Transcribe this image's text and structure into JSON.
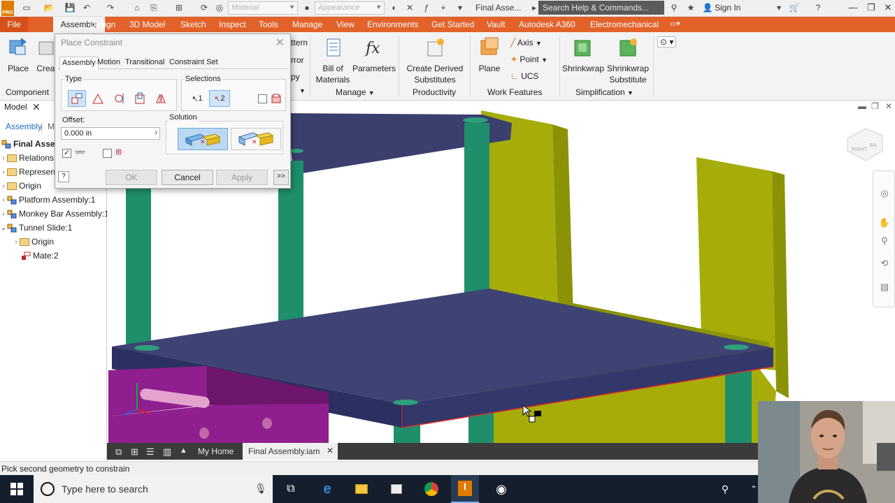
{
  "titlebar": {
    "app_logo": "PRO",
    "material_placeholder": "Material",
    "appearance_placeholder": "Appearance",
    "doc_title": "Final Asse...",
    "search_placeholder": "Search Help & Commands...",
    "sign_in": "Sign In"
  },
  "tabs": {
    "file": "File",
    "items": [
      "Assemble",
      "Design",
      "3D Model",
      "Sketch",
      "Inspect",
      "Tools",
      "Manage",
      "View",
      "Environments",
      "Get Started",
      "Vault",
      "Autodesk A360",
      "Electromechanical"
    ]
  },
  "ribbon": {
    "place": "Place",
    "create": "Creat",
    "component_group": "Component",
    "pattern": "ttern",
    "mirror": "rror",
    "copy": "py",
    "bill_of_materials_1": "Bill of",
    "bill_of_materials_2": "Materials",
    "parameters": "Parameters",
    "manage_group": "Manage",
    "create_derived_1": "Create Derived",
    "create_derived_2": "Substitutes",
    "productivity_group": "Productivity",
    "plane": "Plane",
    "axis": "Axis",
    "point": "Point",
    "ucs": "UCS",
    "work_features_group": "Work Features",
    "shrinkwrap": "Shrinkwrap",
    "shrinkwrap_sub_1": "Shrinkwrap",
    "shrinkwrap_sub_2": "Substitute",
    "simplification_group": "Simplification"
  },
  "browser": {
    "model_tab": "Model",
    "assembly_tab": "Assembly",
    "mo_tab": "Mo",
    "items": [
      {
        "label": "Final Assem",
        "bold": true
      },
      {
        "label": "Relations"
      },
      {
        "label": "Represen"
      },
      {
        "label": "Origin"
      },
      {
        "label": "Platform Assembly:1"
      },
      {
        "label": "Monkey Bar Assembly:1"
      },
      {
        "label": "Tunnel Slide:1"
      },
      {
        "label": "Origin"
      },
      {
        "label": "Mate:2"
      }
    ]
  },
  "dialog": {
    "title": "Place Constraint",
    "tabs": [
      "Assembly",
      "Motion",
      "Transitional",
      "Constraint Set"
    ],
    "type_label": "Type",
    "selections_label": "Selections",
    "sel1": "1",
    "sel2": "2",
    "offset_label": "Offset:",
    "offset_value": "0.000 in",
    "solution_label": "Solution",
    "ok": "OK",
    "cancel": "Cancel",
    "apply": "Apply",
    "more": ">>"
  },
  "doctabs": {
    "home": "My Home",
    "active_doc": "Final Assembly.iam"
  },
  "status": "Pick second geometry to constrain",
  "taskbar": {
    "search_placeholder": "Type here to search"
  },
  "colors": {
    "ribbon_tab_bar": "#e2622a",
    "platform_blue": "#3a3f6e",
    "post_green": "#1f8f6b",
    "wall_olive": "#a6ad0a",
    "slide_purple": "#8f1f8e"
  }
}
